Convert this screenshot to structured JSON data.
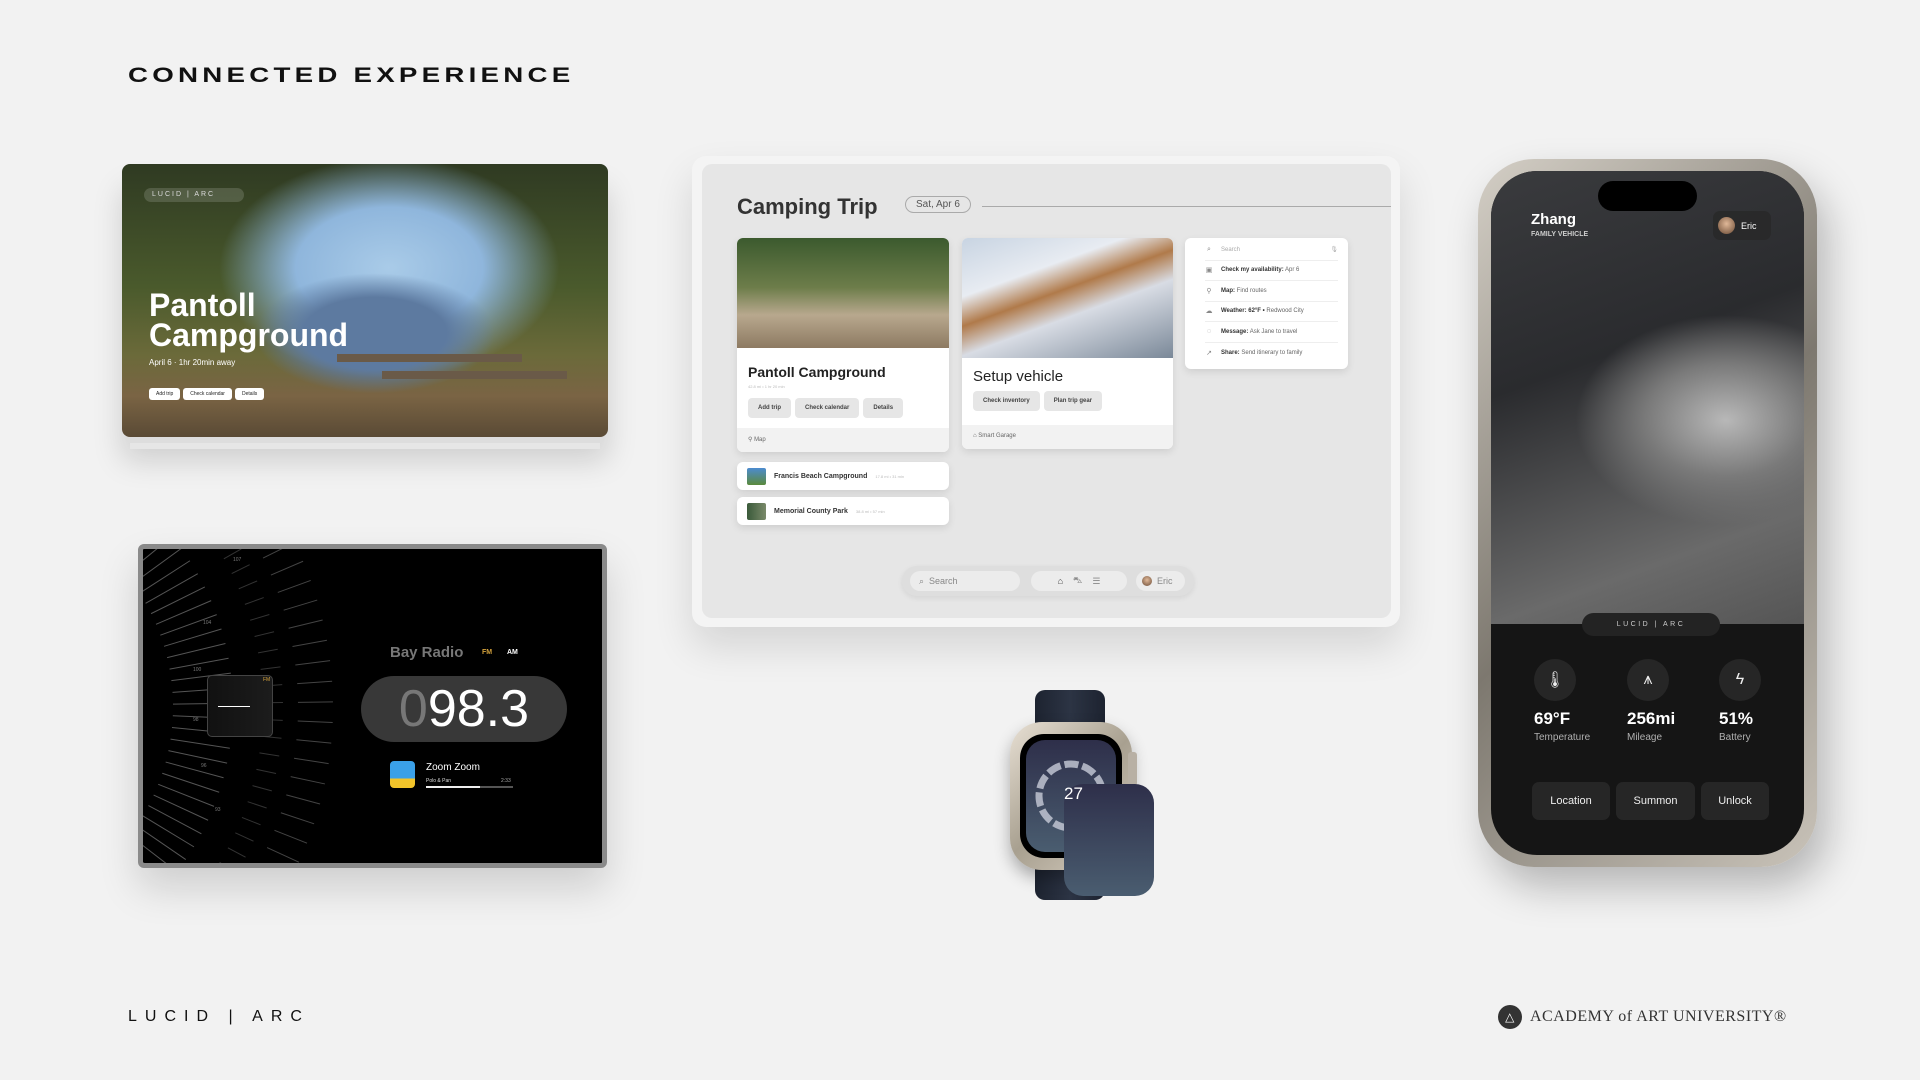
{
  "header": {
    "title": "CONNECTED EXPERIENCE"
  },
  "campground_display": {
    "brand": "LUCID | ARC",
    "title_line1": "Pantoll",
    "title_line2": "Campground",
    "subtitle": "April 6 · 1hr 20min away",
    "buttons": [
      "Add trip",
      "Check calendar",
      "Details"
    ]
  },
  "radio": {
    "station": "Bay Radio",
    "bands": [
      "FM",
      "AM"
    ],
    "active_band": "FM",
    "frequency_lead": "0",
    "frequency": "98.3",
    "dial_labels": [
      "107",
      "104",
      "100",
      "98",
      "96",
      "93"
    ],
    "dial_band": "FM",
    "song": {
      "title": "Zoom Zoom",
      "artist": "Polo & Pan",
      "duration": "2:33",
      "progress": 0.62
    }
  },
  "trip": {
    "title": "Camping Trip",
    "date": "Sat, Apr 6",
    "main_card": {
      "title": "Pantoll Campground",
      "meta": "42.8 mi • 1 hr 20 min",
      "buttons": [
        "Add trip",
        "Check calendar",
        "Details"
      ],
      "footer": "Map"
    },
    "alternatives": [
      {
        "name": "Francis Beach Campground",
        "meta": "17.8 mi • 31 min"
      },
      {
        "name": "Memorial County Park",
        "meta": "38.8 mi • 57 min"
      }
    ],
    "vehicle_card": {
      "title": "Setup vehicle",
      "buttons": [
        "Check inventory",
        "Plan trip gear"
      ],
      "footer": "Smart Garage"
    },
    "search_panel": {
      "placeholder": "Search",
      "items": [
        {
          "icon": "calendar-icon",
          "bold": "Check my availability:",
          "text": "Apr 6"
        },
        {
          "icon": "map-pin-icon",
          "bold": "Map:",
          "text": "Find routes"
        },
        {
          "icon": "cloud-icon",
          "bold": "Weather: 62°F •",
          "text": "Redwood City"
        },
        {
          "icon": "message-icon",
          "bold": "Message:",
          "text": "Ask Jane to travel"
        },
        {
          "icon": "share-icon",
          "bold": "Share:",
          "text": "Send itinerary to family"
        }
      ]
    },
    "bottom_bar": {
      "search_placeholder": "Search",
      "user": "Eric"
    }
  },
  "watch": {
    "value": "27"
  },
  "phone": {
    "owner": "Zhang",
    "subtitle": "FAMILY VEHICLE",
    "user": "Eric",
    "brand": "LUCID | ARC",
    "stats": [
      {
        "icon": "thermometer-icon",
        "value": "69°F",
        "label": "Temperature"
      },
      {
        "icon": "road-icon",
        "value": "256mi",
        "label": "Mileage"
      },
      {
        "icon": "lightning-icon",
        "value": "51%",
        "label": "Battery"
      }
    ],
    "buttons": [
      "Location",
      "Summon",
      "Unlock"
    ]
  },
  "footer": {
    "brand": "LUCID | ARC",
    "university": "ACADEMY of ART UNIVERSITY®"
  },
  "colors": {
    "background": "#f2f2f2",
    "fm_accent": "#d4a23c",
    "phone_bg": "#151515"
  }
}
